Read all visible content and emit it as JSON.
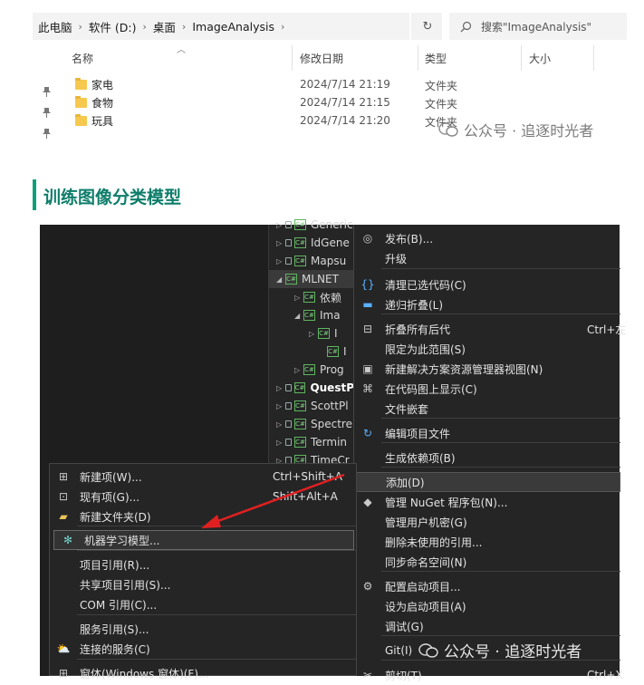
{
  "explorer": {
    "breadcrumb": [
      "此电脑",
      "软件 (D:)",
      "桌面",
      "ImageAnalysis"
    ],
    "search_placeholder": "搜索\"ImageAnalysis\"",
    "columns": {
      "name": "名称",
      "date": "修改日期",
      "type": "类型",
      "size": "大小"
    },
    "files": [
      {
        "name": "家电",
        "date": "2024/7/14 21:19",
        "type": "文件夹"
      },
      {
        "name": "食物",
        "date": "2024/7/14 21:15",
        "type": "文件夹"
      },
      {
        "name": "玩具",
        "date": "2024/7/14 21:20",
        "type": "文件夹"
      }
    ]
  },
  "watermark": "公众号 · 追逐时光者",
  "section_title": "训练图像分类模型",
  "solution_tree": [
    {
      "label": "Generic",
      "expander": "▷"
    },
    {
      "label": "IdGene",
      "expander": "▷"
    },
    {
      "label": "Mapsu",
      "expander": "▷"
    },
    {
      "label": "MLNET",
      "expander": "◢"
    },
    {
      "label": "依赖",
      "expander": "▷"
    },
    {
      "label": "Ima",
      "expander": "◢"
    },
    {
      "label": "I",
      "expander": "▷"
    },
    {
      "label": "I",
      "expander": ""
    },
    {
      "label": "Prog",
      "expander": "▷"
    },
    {
      "label": "QuestP",
      "expander": "▷"
    },
    {
      "label": "ScottPl",
      "expander": "▷"
    },
    {
      "label": "Spectre",
      "expander": "▷"
    },
    {
      "label": "Termin",
      "expander": "▷"
    },
    {
      "label": "TimeCr",
      "expander": "▷"
    }
  ],
  "context_menu": [
    {
      "label": "发布(B)..."
    },
    {
      "label": "升级"
    },
    {
      "label": "清理已选代码(C)"
    },
    {
      "label": "递归折叠(L)"
    },
    {
      "label": "折叠所有后代",
      "shortcut": "Ctrl+左"
    },
    {
      "label": "限定为此范围(S)"
    },
    {
      "label": "新建解决方案资源管理器视图(N)"
    },
    {
      "label": "在代码图上显示(C)"
    },
    {
      "label": "文件嵌套"
    },
    {
      "label": "编辑项目文件"
    },
    {
      "label": "生成依赖项(B)"
    },
    {
      "label": "添加(D)"
    },
    {
      "label": "管理 NuGet 程序包(N)..."
    },
    {
      "label": "管理用户机密(G)"
    },
    {
      "label": "删除未使用的引用..."
    },
    {
      "label": "同步命名空间(N)"
    },
    {
      "label": "配置启动项目..."
    },
    {
      "label": "设为启动项目(A)"
    },
    {
      "label": "调试(G)"
    },
    {
      "label": "Git(I)"
    },
    {
      "label": "剪切(T)",
      "shortcut": "Ctrl+X"
    }
  ],
  "add_submenu": [
    {
      "label": "新建项(W)...",
      "shortcut": "Ctrl+Shift+A"
    },
    {
      "label": "现有项(G)...",
      "shortcut": "Shift+Alt+A"
    },
    {
      "label": "新建文件夹(D)"
    },
    {
      "label": "机器学习模型..."
    },
    {
      "label": "项目引用(R)..."
    },
    {
      "label": "共享项目引用(S)..."
    },
    {
      "label": "COM 引用(C)..."
    },
    {
      "label": "服务引用(S)..."
    },
    {
      "label": "连接的服务(C)"
    },
    {
      "label": "窗体(Windows 窗体)(F)..."
    }
  ],
  "colors": {
    "accent": "#0aa07a",
    "title": "#0e7d6a",
    "arrow": "#e02020",
    "dark_bg": "#1e1e1e",
    "menu_bg": "#252526"
  }
}
